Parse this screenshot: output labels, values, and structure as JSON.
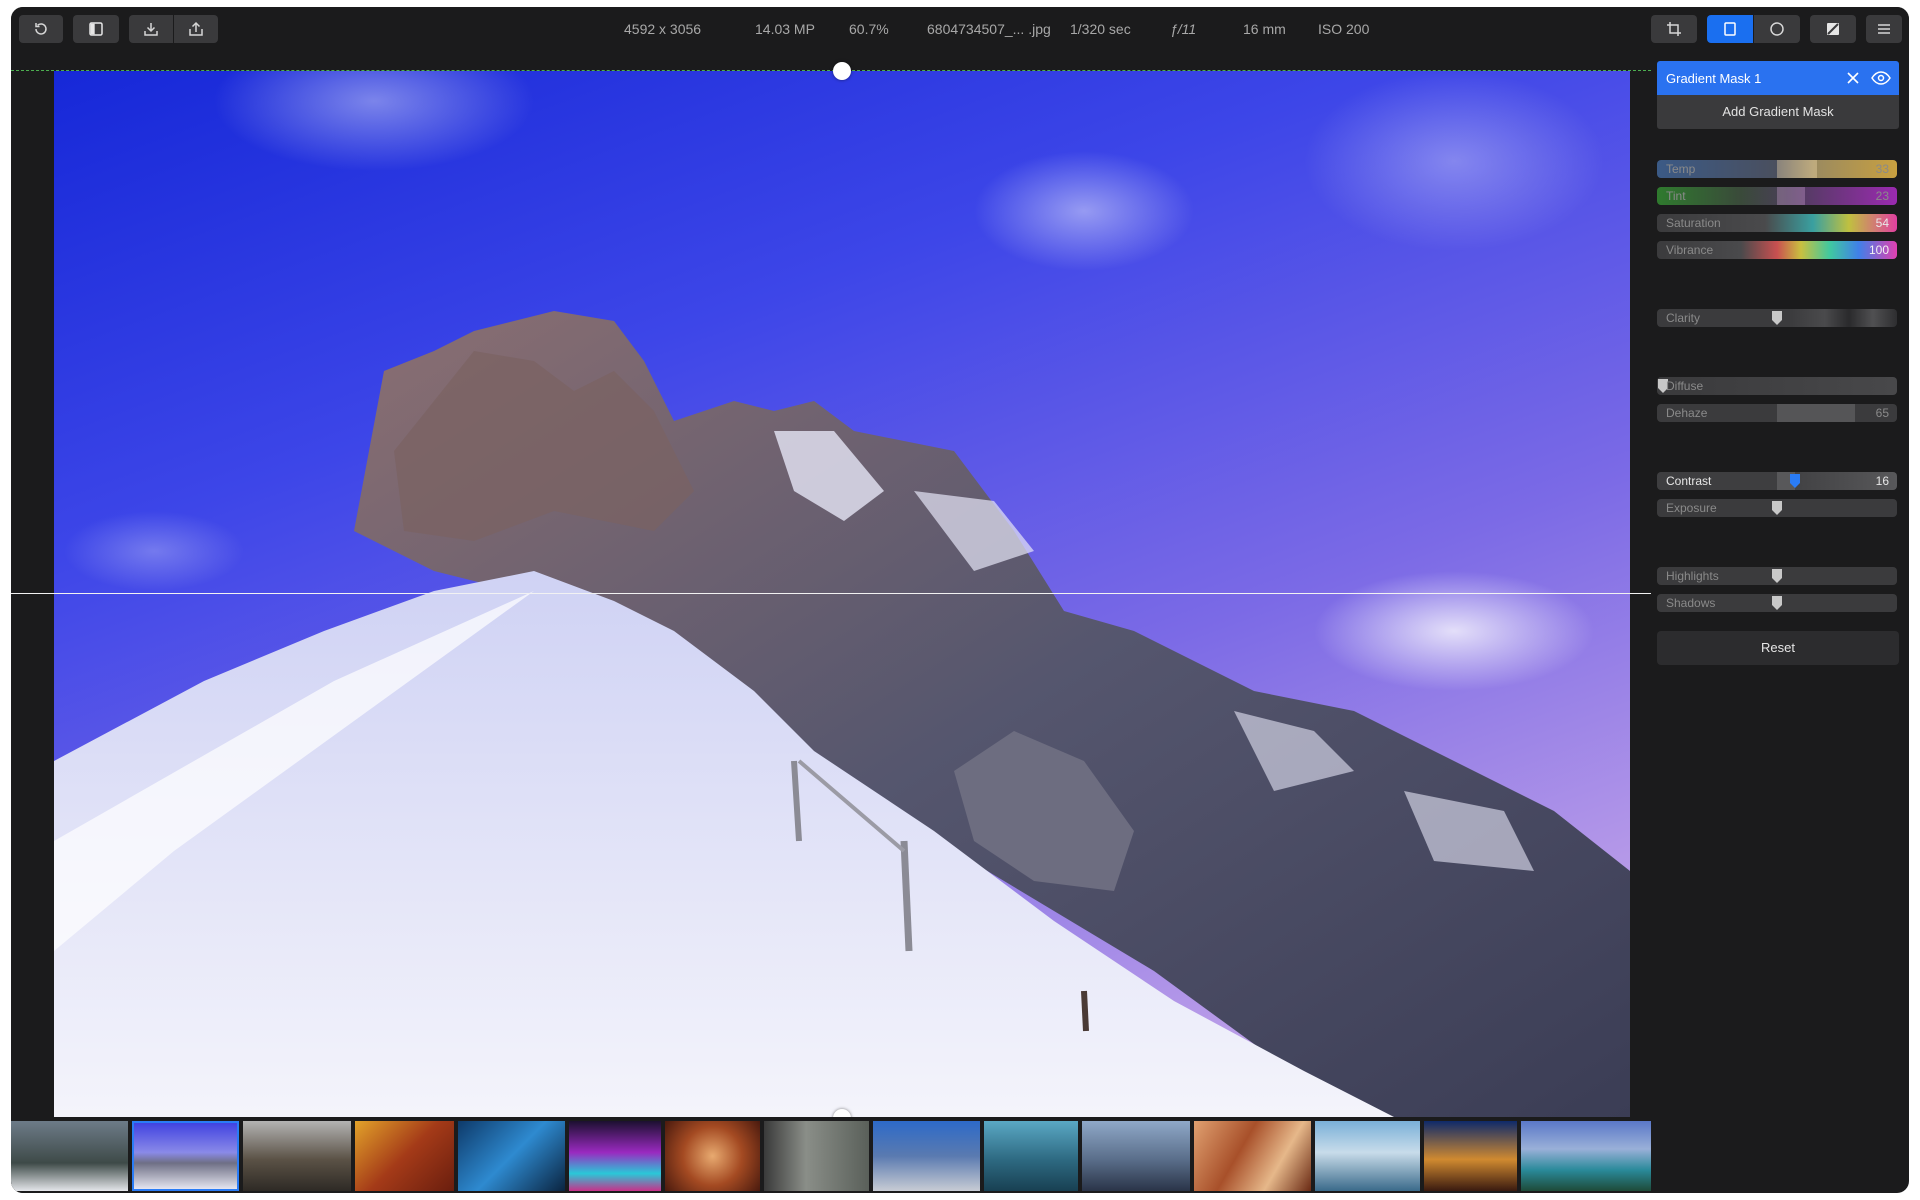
{
  "toolbar": {
    "left_buttons": [
      "undo-icon",
      "sidebar-toggle-icon",
      "import-icon",
      "export-icon"
    ],
    "right_buttons": [
      "crop-icon",
      "linear-gradient-icon",
      "radial-mask-icon",
      "brush-mask-icon",
      "menu-icon"
    ],
    "active_right_button": "linear-gradient-icon"
  },
  "image_info": {
    "dimensions": "4592 x 3056",
    "megapixels": "14.03 MP",
    "zoom": "60.7%",
    "filename": "6804734507_... .jpg",
    "shutter": "1/320 sec",
    "aperture": "ƒ/11",
    "focal_length": "16 mm",
    "iso": "ISO 200"
  },
  "panel": {
    "mask_title": "Gradient Mask 1",
    "add_mask_label": "Add Gradient Mask",
    "sliders": [
      {
        "key": "temp",
        "label": "Temp",
        "value": "33",
        "level": 33
      },
      {
        "key": "tint",
        "label": "Tint",
        "value": "23",
        "level": 23
      },
      {
        "key": "saturation",
        "label": "Saturation",
        "value": "54",
        "level": 54
      },
      {
        "key": "vibrance",
        "label": "Vibrance",
        "value": "100",
        "level": 100
      },
      {
        "key": "clarity",
        "label": "Clarity",
        "value": "",
        "level": 0
      },
      {
        "key": "diffuse",
        "label": "Diffuse",
        "value": "",
        "level": 0
      },
      {
        "key": "dehaze",
        "label": "Dehaze",
        "value": "65",
        "level": 65
      },
      {
        "key": "contrast",
        "label": "Contrast",
        "value": "16",
        "level": 16
      },
      {
        "key": "exposure",
        "label": "Exposure",
        "value": "",
        "level": 0
      },
      {
        "key": "highlights",
        "label": "Highlights",
        "value": "",
        "level": 0
      },
      {
        "key": "shadows",
        "label": "Shadows",
        "value": "",
        "level": 0
      }
    ],
    "reset_label": "Reset"
  },
  "colors": {
    "accent": "#2a72f0",
    "window_bg": "#1b1b1c",
    "button_bg": "#3a3a3c"
  },
  "filmstrip": {
    "selected_index": 1,
    "count": 15
  }
}
